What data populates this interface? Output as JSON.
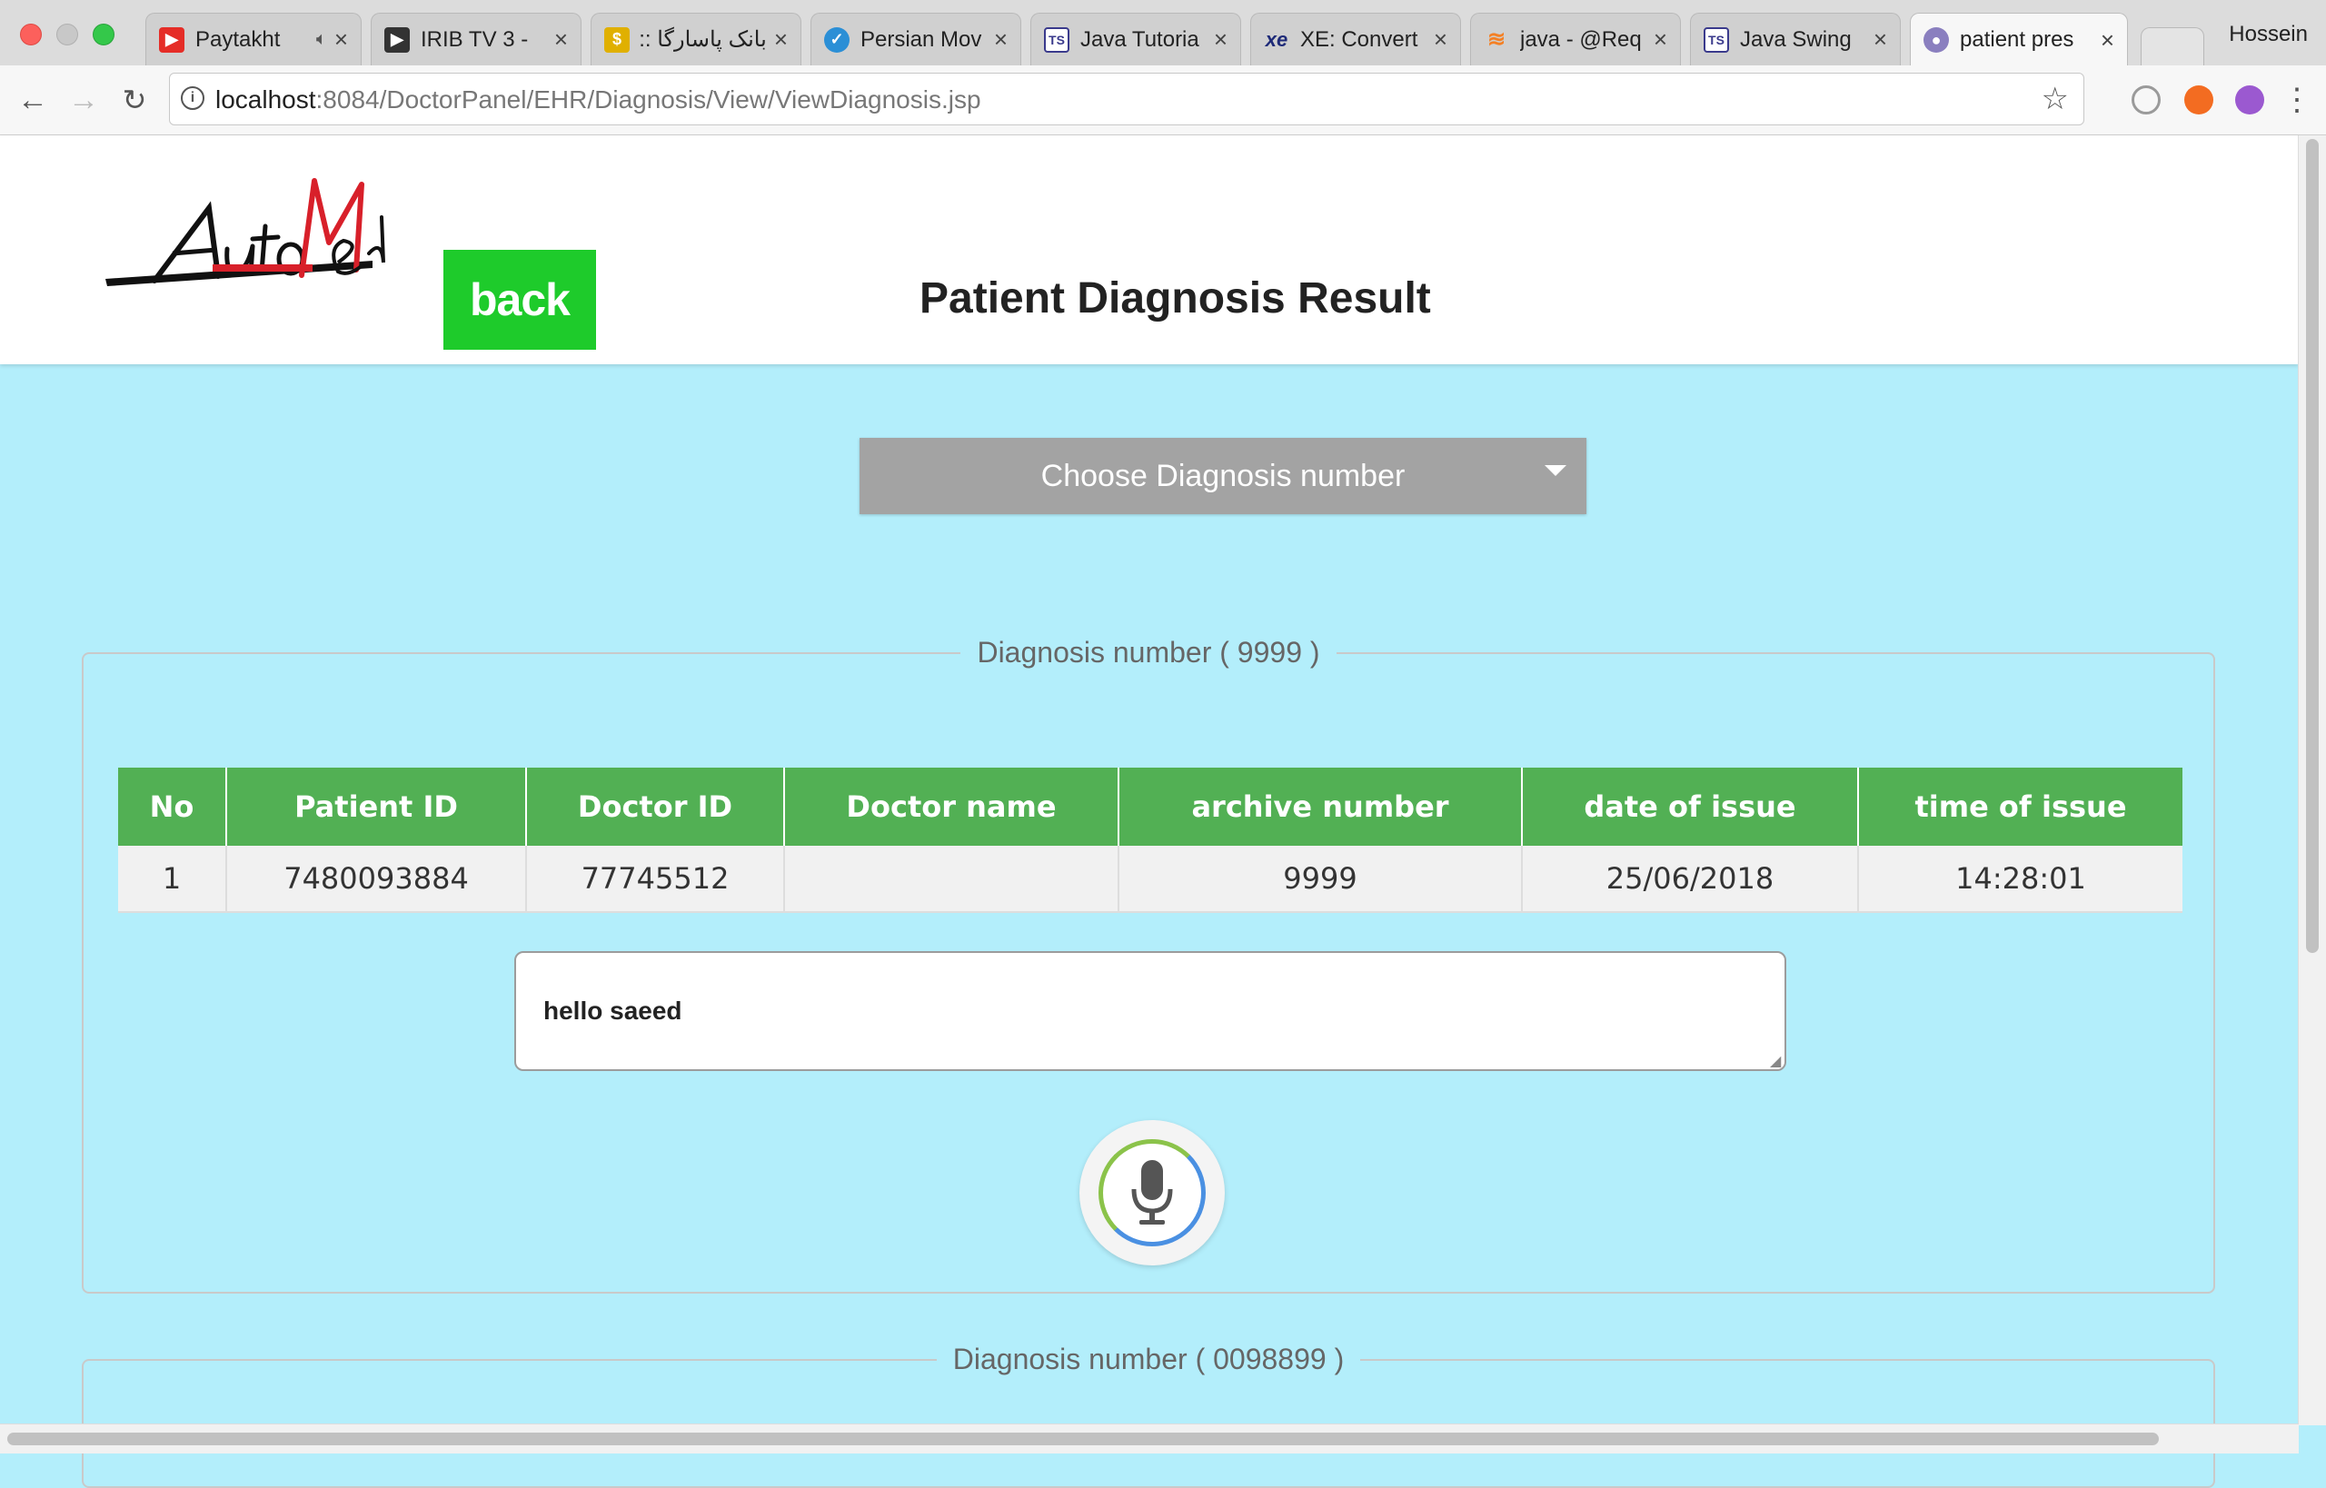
{
  "browser": {
    "tabs": [
      {
        "label": "Paytakht",
        "icon": "youtube-icon",
        "color": "#e52d27",
        "muted_indicator": true
      },
      {
        "label": "IRIB TV 3 -",
        "icon": "play-icon",
        "color": "#333333"
      },
      {
        "label": "بانک پاسارگا ::",
        "icon": "bank-icon",
        "color": "#e0b000"
      },
      {
        "label": "Persian Mov",
        "icon": "globe-icon",
        "color": "#2b8fd6"
      },
      {
        "label": "Java Tutoria",
        "icon": "document-icon",
        "color": "#3a3a8c"
      },
      {
        "label": "XE: Convert",
        "icon": "xe-icon",
        "color": "#1e2a78"
      },
      {
        "label": "java - @Req",
        "icon": "stackoverflow-icon",
        "color": "#f48024"
      },
      {
        "label": "Java Swing",
        "icon": "document-icon",
        "color": "#3a3a8c"
      },
      {
        "label": "patient pres",
        "icon": "avatar-icon",
        "color": "#8a7fbf",
        "active": true
      }
    ],
    "profile_name": "Hossein",
    "url_host": "localhost",
    "url_path": ":8084/DoctorPanel/EHR/Diagnosis/View/ViewDiagnosis.jsp"
  },
  "header": {
    "logo_text": "AutoMed",
    "back_label": "back",
    "title": "Patient Diagnosis Result"
  },
  "select": {
    "label": "Choose Diagnosis number"
  },
  "diagnoses": [
    {
      "legend": "Diagnosis number ( 9999 )",
      "columns": [
        "No",
        "Patient ID",
        "Doctor ID",
        "Doctor name",
        "archive number",
        "date of issue",
        "time of issue"
      ],
      "rows": [
        [
          "1",
          "7480093884",
          "77745512",
          "",
          "9999",
          "25/06/2018",
          "14:28:01"
        ]
      ],
      "note": "hello saeed"
    },
    {
      "legend": "Diagnosis number ( 0098899 )"
    }
  ],
  "colors": {
    "page_bg": "#b3eefb",
    "back_button": "#1ecb2b",
    "table_header": "#52b054",
    "select_bg": "#a3a3a3"
  }
}
